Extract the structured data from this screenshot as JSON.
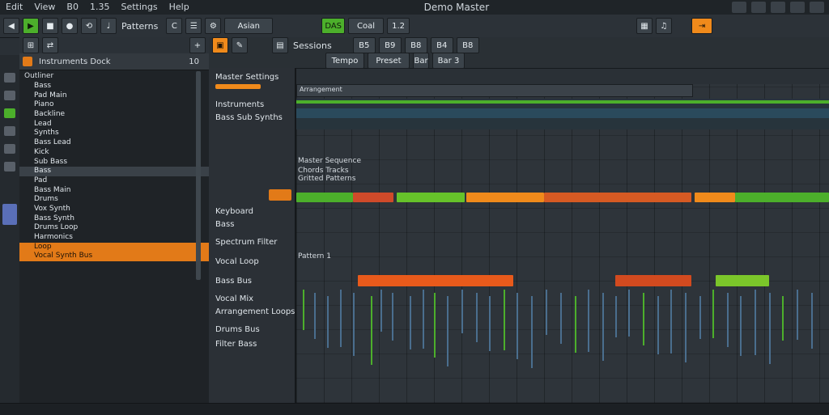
{
  "menu": [
    "Edit",
    "View",
    "B0",
    "1.35",
    "Settings",
    "Help"
  ],
  "menu_right": "Demo Master",
  "toolbar": {
    "pattern_label": "Patterns",
    "display_label": "Asian",
    "mode_label": "DAS",
    "cpu_label": "Coal",
    "counter": "1.2"
  },
  "browser": {
    "title": "Instruments Dock",
    "counter": "10",
    "section": "Outliner",
    "items": [
      "Bass",
      "Pad Main",
      "Piano",
      "Backline",
      "Lead",
      "Synths",
      "Bass Lead",
      "Kick",
      "Sub Bass",
      "Bass",
      "Pad",
      "Bass Main",
      "Drums",
      "Vox Synth",
      "Bass Synth",
      "Drums Loop",
      "Harmonics"
    ],
    "bottom_items": [
      "Loop",
      "Vocal Synth Bus"
    ]
  },
  "chan_toolbar": {
    "title": "Sessions",
    "buttons": [
      "B5",
      "B9",
      "B8",
      "B4",
      "B8"
    ],
    "row2": [
      "Tempo",
      "Preset",
      "Bar",
      "Bar 3"
    ]
  },
  "channel_labels": {
    "top": "Master Settings",
    "a": "Instruments",
    "b": "Bass Sub Synths",
    "c1": "Keyboard",
    "c2": "Bass",
    "d1": "Spectrum Filter",
    "d2": "Vocal Loop",
    "e": "Bass Bus",
    "f": "Vocal Mix",
    "g": "Arrangement Loops",
    "h": "Drums Bus",
    "i": "Filter Bass"
  },
  "grid_text": {
    "top": "Arrangement",
    "mid_title": "Master Sequence",
    "mid_sub": "Chords Tracks",
    "mid_sub2": "Gritted Patterns",
    "lower": "Pattern 1"
  },
  "colors": {
    "accent_green": "#4caf2b",
    "accent_orange": "#f08a1b",
    "accent_red": "#cf4a2a"
  }
}
